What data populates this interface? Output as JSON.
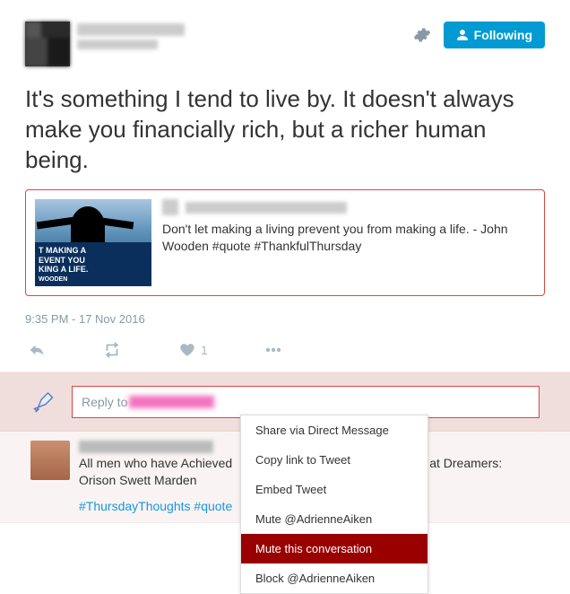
{
  "header": {
    "following_label": "Following"
  },
  "tweet": {
    "text": "It's something I tend to live by. It doesn't always make you financially rich, but a richer human being."
  },
  "quoted": {
    "text": "Don't let making a living prevent you from making a life. - John Wooden #quote #ThankfulThursday",
    "image_caption_line1": "T MAKING A",
    "image_caption_line2": "EVENT YOU",
    "image_caption_line3": "KING A LIFE.",
    "image_author": "WOODEN"
  },
  "timestamp": "9:35 PM - 17 Nov 2016",
  "actions": {
    "like_count": "1"
  },
  "menu": {
    "items": [
      "Share via Direct Message",
      "Copy link to Tweet",
      "Embed Tweet",
      "Mute @AdrienneAiken",
      "Mute this conversation",
      "Block @AdrienneAiken"
    ],
    "selected_index": 4
  },
  "reply": {
    "placeholder_prefix": "Reply to "
  },
  "below": {
    "text_suffix": "at Dreamers: Orison Swett Marden",
    "text_prefix": "All men who have Achieved",
    "hashtags": "#ThursdayThoughts #quote"
  }
}
